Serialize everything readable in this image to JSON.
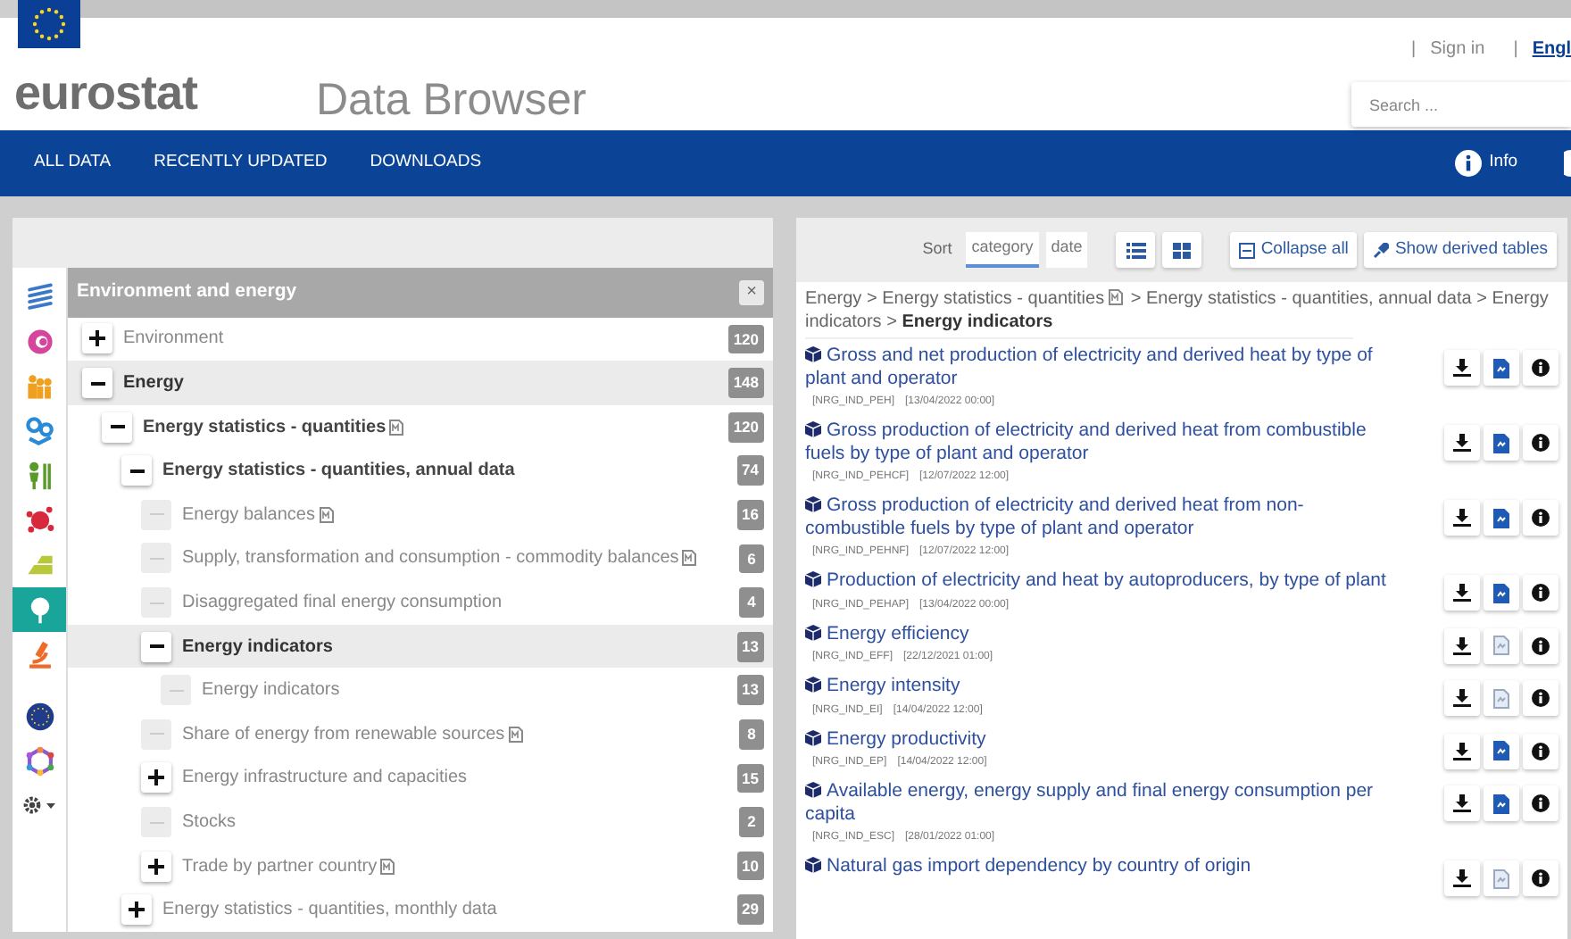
{
  "header": {
    "logo": "eurostat",
    "app_title": "Data Browser",
    "links": [
      {
        "separator": "|",
        "label": "Sign in"
      },
      {
        "separator": "|",
        "label": "Engl"
      }
    ],
    "search": {
      "placeholder": "Search ..."
    }
  },
  "nav": {
    "items": [
      "ALL DATA",
      "RECENTLY UPDATED",
      "DOWNLOADS"
    ],
    "info": "Info"
  },
  "themes": [
    {
      "kind": "lines",
      "color": "#3a78c9",
      "selected": false
    },
    {
      "kind": "ring",
      "color": "#d4459b",
      "selected": false
    },
    {
      "kind": "people",
      "color": "#f0a020",
      "selected": false
    },
    {
      "kind": "nodes",
      "color": "#2a8ad6",
      "selected": false
    },
    {
      "kind": "figures",
      "color": "#5a9a2a",
      "selected": false
    },
    {
      "kind": "dots",
      "color": "#d8283c",
      "selected": false
    },
    {
      "kind": "stack",
      "color": "#b8c83a",
      "selected": false
    },
    {
      "kind": "leaf",
      "color": "#1aa59a",
      "selected": true
    },
    {
      "kind": "microscope",
      "color": "#f06a28",
      "selected": false
    },
    {
      "kind": "stars",
      "color": "#1f3b8c",
      "selected": false
    },
    {
      "kind": "network",
      "color": "#8a5ad0",
      "selected": false
    }
  ],
  "tree": {
    "title": "Environment and energy",
    "close": "×",
    "items": [
      {
        "label": "Environment",
        "kind": "folder",
        "expanded": false,
        "selected": false,
        "metadata": false,
        "count": "120"
      },
      {
        "label": "Energy",
        "kind": "folder",
        "expanded": true,
        "selected": true,
        "metadata": false,
        "count": "148",
        "children": [
          {
            "label": "Energy statistics - quantities",
            "kind": "folder",
            "expanded": true,
            "selected": false,
            "metadata": true,
            "count": "120",
            "children": [
              {
                "label": "Energy statistics - quantities, annual data",
                "kind": "folder",
                "expanded": true,
                "selected": false,
                "metadata": false,
                "count": "74",
                "children": [
                  {
                    "label": "Energy balances",
                    "kind": "leaf",
                    "selected": false,
                    "metadata": true,
                    "count": "16"
                  },
                  {
                    "label": "Supply, transformation and consumption - commodity balances",
                    "kind": "leaf",
                    "selected": false,
                    "metadata": true,
                    "count": "6"
                  },
                  {
                    "label": "Disaggregated final energy consumption",
                    "kind": "leaf",
                    "selected": false,
                    "metadata": false,
                    "count": "4"
                  },
                  {
                    "label": "Energy indicators",
                    "kind": "folder",
                    "expanded": true,
                    "selected": true,
                    "metadata": false,
                    "count": "13",
                    "children": [
                      {
                        "label": "Energy indicators",
                        "kind": "leaf",
                        "selected": false,
                        "metadata": false,
                        "count": "13"
                      }
                    ]
                  },
                  {
                    "label": "Share of energy from renewable sources",
                    "kind": "leaf",
                    "selected": false,
                    "metadata": true,
                    "count": "8"
                  },
                  {
                    "label": "Energy infrastructure and capacities",
                    "kind": "folder",
                    "expanded": false,
                    "selected": false,
                    "metadata": false,
                    "count": "15"
                  },
                  {
                    "label": "Stocks",
                    "kind": "leaf",
                    "selected": false,
                    "metadata": false,
                    "count": "2"
                  },
                  {
                    "label": "Trade by partner country",
                    "kind": "folder",
                    "expanded": false,
                    "selected": false,
                    "metadata": true,
                    "count": "10"
                  }
                ]
              },
              {
                "label": "Energy statistics - quantities, monthly data",
                "kind": "folder",
                "expanded": false,
                "selected": false,
                "metadata": false,
                "count": "29"
              }
            ]
          }
        ]
      }
    ]
  },
  "toolbar": {
    "sort_label": "Sort",
    "sort_options": [
      {
        "label": "category",
        "selected": true
      },
      {
        "label": "date",
        "selected": false
      }
    ],
    "views": [
      {
        "kind": "list",
        "selected": false
      },
      {
        "kind": "grid",
        "selected": false
      }
    ],
    "collapse": "Collapse all",
    "derived": "Show derived tables"
  },
  "breadcrumb": [
    {
      "label": "Energy",
      "metadata": false
    },
    {
      "label": "Energy statistics - quantities",
      "metadata": true
    },
    {
      "label": "Energy statistics - quantities, annual data",
      "metadata": false
    },
    {
      "label": "Energy indicators",
      "metadata": false
    },
    {
      "label": "Energy indicators",
      "metadata": false
    }
  ],
  "breadcrumb_separator": ">",
  "datasets": [
    {
      "title": "Gross and net production of electricity and derived heat by type of plant and operator",
      "code": "[NRG_IND_PEH]",
      "date": "[13/04/2022 00:00]",
      "metadata": true
    },
    {
      "title": "Gross production of electricity and derived heat from combustible fuels by type of plant and operator",
      "code": "[NRG_IND_PEHCF]",
      "date": "[12/07/2022 12:00]",
      "metadata": true
    },
    {
      "title": "Gross production of electricity and derived heat from non-combustible fuels by type of plant and operator",
      "code": "[NRG_IND_PEHNF]",
      "date": "[12/07/2022 12:00]",
      "metadata": true
    },
    {
      "title": "Production of electricity and heat by autoproducers, by type of plant",
      "code": "[NRG_IND_PEHAP]",
      "date": "[13/04/2022 00:00]",
      "metadata": true
    },
    {
      "title": "Energy efficiency",
      "code": "[NRG_IND_EFF]",
      "date": "[22/12/2021 01:00]",
      "metadata": false
    },
    {
      "title": "Energy intensity",
      "code": "[NRG_IND_EI]",
      "date": "[14/04/2022 12:00]",
      "metadata": false
    },
    {
      "title": "Energy productivity",
      "code": "[NRG_IND_EP]",
      "date": "[14/04/2022 12:00]",
      "metadata": true
    },
    {
      "title": "Available energy, energy supply and final energy consumption per capita",
      "code": "[NRG_IND_ESC]",
      "date": "[28/01/2022 01:00]",
      "metadata": true
    },
    {
      "title": "Natural gas import dependency by country of origin",
      "metadata": false
    }
  ]
}
